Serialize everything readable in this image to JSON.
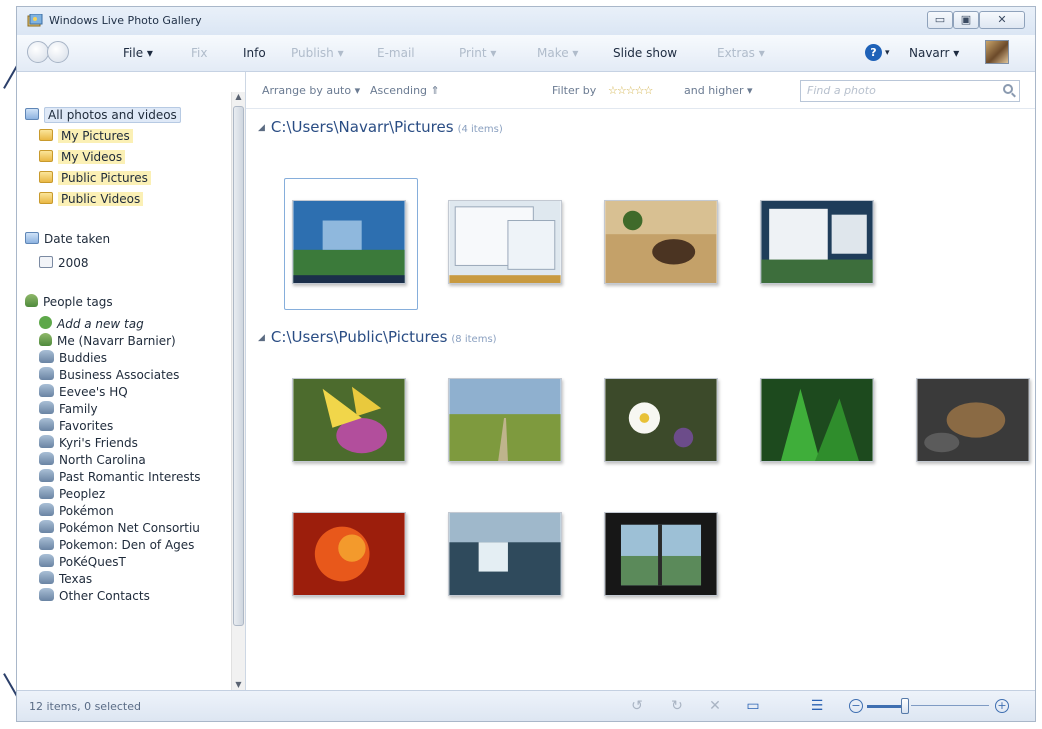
{
  "window": {
    "title": "Windows Live Photo Gallery"
  },
  "toolbar": {
    "file": "File ▾",
    "fix": "Fix",
    "info": "Info",
    "publish": "Publish ▾",
    "email": "E-mail",
    "print": "Print ▾",
    "make": "Make ▾",
    "slideshow": "Slide show",
    "extras": "Extras ▾",
    "help_icon": "help-icon",
    "user": "Navarr ▾"
  },
  "sidebar": {
    "items": [
      {
        "label": "All photos and videos",
        "icon": "folder-blue-icon"
      },
      {
        "label": "My Pictures",
        "icon": "folder-icon"
      },
      {
        "label": "My Videos",
        "icon": "folder-icon"
      },
      {
        "label": "Public Pictures",
        "icon": "folder-icon"
      },
      {
        "label": "Public Videos",
        "icon": "folder-icon"
      }
    ],
    "date_taken": {
      "label": "Date taken",
      "year": "2008"
    },
    "people_tags": {
      "label": "People tags",
      "add": "Add a new tag",
      "tags": [
        "Me (Navarr Barnier)",
        "Buddies",
        "Business Associates",
        "Eevee's HQ",
        "Family",
        "Favorites",
        "Kyri's Friends",
        "North Carolina",
        "Past Romantic Interests",
        "Peoplez",
        "Pokémon",
        "Pokémon Net Consortiu",
        "Pokemon: Den of Ages",
        "PoKéQuesT",
        "Texas",
        "Other Contacts"
      ]
    }
  },
  "filterbar": {
    "arrange": "Arrange by auto ▾",
    "order": "Ascending ⇑",
    "filter_by": "Filter by",
    "stars": "☆☆☆☆☆",
    "and_higher": "and higher ▾",
    "search_placeholder": "Find a photo"
  },
  "groups": [
    {
      "path": "C:\\Users\\Navarr\\Pictures",
      "count": "(4 items)"
    },
    {
      "path": "C:\\Users\\Public\\Pictures",
      "count": "(8 items)"
    }
  ],
  "status": {
    "text": "12 items, 0 selected"
  },
  "colors": {
    "accent": "#2a4d84",
    "selection": "#86aedb"
  }
}
